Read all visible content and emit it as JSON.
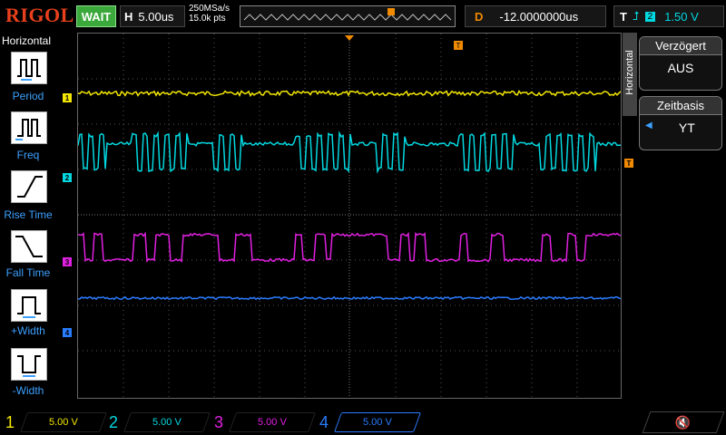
{
  "brand": {
    "logo": "RIGOL",
    "status": "WAIT"
  },
  "timebase": {
    "label": "H",
    "value": "5.00us"
  },
  "acquisition": {
    "sample_rate": "250MSa/s",
    "points": "15.0k pts"
  },
  "trigger_delay": {
    "label": "D",
    "value": "-12.0000000us"
  },
  "trigger_info": {
    "label": "T",
    "channel": "2",
    "level": "1.50 V"
  },
  "left_menu": {
    "title": "Horizontal",
    "items": [
      "Period",
      "Freq",
      "Rise Time",
      "Fall Time",
      "+Width",
      "-Width"
    ]
  },
  "right_menu": {
    "tab_label": "Horizontal",
    "groups": [
      {
        "title": "Verzögert",
        "value": "AUS"
      },
      {
        "title": "Zeitbasis",
        "value": "YT"
      }
    ]
  },
  "channels": [
    {
      "num": "1",
      "scale": "5.00 V",
      "color": "#f2e600"
    },
    {
      "num": "2",
      "scale": "5.00 V",
      "color": "#00d8e0"
    },
    {
      "num": "3",
      "scale": "5.00 V",
      "color": "#e020e0"
    },
    {
      "num": "4",
      "scale": "5.00 V",
      "color": "#2a7cff"
    }
  ],
  "trigger_marker": "T",
  "colors": {
    "grid": "#555555",
    "trigger": "#f08a00",
    "menu_accent": "#3ca0ff"
  }
}
